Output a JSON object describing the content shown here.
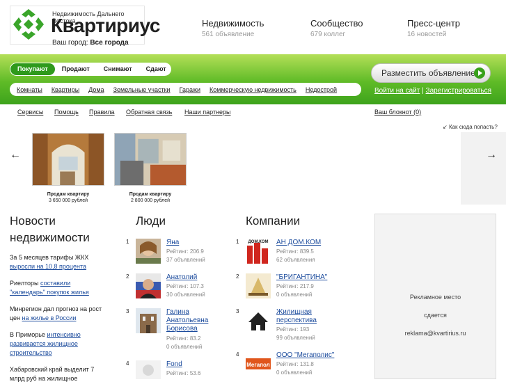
{
  "logo": {
    "subtitle": "Недвижимость Дальнего Востока",
    "name": "Квартириус"
  },
  "city": {
    "label": "Ваш город:",
    "value": "Все города"
  },
  "stats": [
    {
      "title": "Недвижимость",
      "sub": "561 объявление"
    },
    {
      "title": "Сообщество",
      "sub": "679 коллег"
    },
    {
      "title": "Пресс-центр",
      "sub": "16 новостей"
    }
  ],
  "modes": [
    "Покупают",
    "Продают",
    "Снимают",
    "Сдают"
  ],
  "categories": [
    "Комнаты",
    "Квартиры",
    "Дома",
    "Земельные участки",
    "Гаражи",
    "Коммерческую недвижимость",
    "Недострой"
  ],
  "post_button": "Разместить объявление",
  "auth": {
    "login": "Войти на сайт",
    "sep": "|",
    "register": "Зарегистрироваться"
  },
  "subnav": [
    "Сервисы",
    "Помощь",
    "Правила",
    "Обратная связь",
    "Наши партнеры"
  ],
  "notebook": "Ваш блокнот (0)",
  "how_link": "Как сюда попасть?",
  "listings": [
    {
      "caption": "Продам квартиру",
      "price": "3 650 000 рублей"
    },
    {
      "caption": "Продам квартиру",
      "price": "2 800 000 рублей"
    }
  ],
  "news": {
    "heading": "Новости недвижимости",
    "items": [
      {
        "text": "За 5 месяцев тарифы ЖКХ",
        "link": "выросли на 10,8 процента"
      },
      {
        "text": "Риелторы",
        "link": "составили \"календарь\" покупок жилья"
      },
      {
        "text": "Минрегион дал прогноз на рост цен",
        "link": "на жилье в России"
      },
      {
        "text": "В Приморье",
        "link": "интенсивно развивается жилищное строительство"
      },
      {
        "text": "Хабаровский край выделит 7 млрд руб на жилищное",
        "link": ""
      }
    ]
  },
  "people": {
    "heading": "Люди",
    "items": [
      {
        "num": "1",
        "name": "Яна",
        "rating": "Рейтинг: 206.9",
        "count": "37 объявлений"
      },
      {
        "num": "2",
        "name": "Анатолий",
        "rating": "Рейтинг: 107.3",
        "count": "30 объявлений"
      },
      {
        "num": "3",
        "name": "Галина Анатольевна Борисова",
        "rating": "Рейтинг: 83.2",
        "count": "0 объявлений"
      },
      {
        "num": "4",
        "name": "Fond",
        "rating": "Рейтинг: 53.6",
        "count": ""
      }
    ]
  },
  "companies": {
    "heading": "Компании",
    "items": [
      {
        "num": "1",
        "name": "АН ДОМ.КОМ",
        "rating": "Рейтинг: 839.5",
        "count": "62 объявления",
        "logo_text": "ДОМ.КОМ"
      },
      {
        "num": "2",
        "name": "\"БРИГАНТИНА\"",
        "rating": "Рейтинг: 217.9",
        "count": "0 объявлений",
        "logo_text": ""
      },
      {
        "num": "3",
        "name": "Жилищная перспектива",
        "rating": "Рейтинг: 193",
        "count": "99 объявлений",
        "logo_text": ""
      },
      {
        "num": "4",
        "name": "ООО \"Мегаполис\"",
        "rating": "Рейтинг: 131.8",
        "count": "0 объявлений",
        "logo_text": "Мегапол"
      }
    ]
  },
  "ad": {
    "line1": "Рекламное место",
    "line2": "сдается",
    "email": "reklama@kvartirius.ru"
  }
}
